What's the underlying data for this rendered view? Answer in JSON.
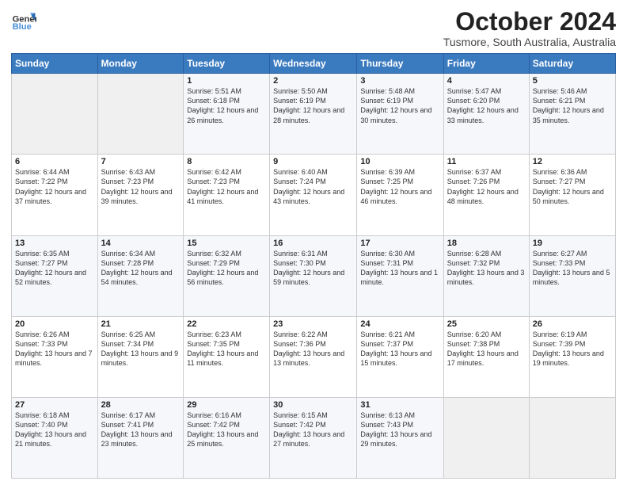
{
  "header": {
    "title": "October 2024",
    "subtitle": "Tusmore, South Australia, Australia"
  },
  "calendar": {
    "days": [
      "Sunday",
      "Monday",
      "Tuesday",
      "Wednesday",
      "Thursday",
      "Friday",
      "Saturday"
    ]
  },
  "weeks": [
    [
      {
        "day": null,
        "info": null
      },
      {
        "day": null,
        "info": null
      },
      {
        "day": "1",
        "info": "Sunrise: 5:51 AM\nSunset: 6:18 PM\nDaylight: 12 hours\nand 26 minutes."
      },
      {
        "day": "2",
        "info": "Sunrise: 5:50 AM\nSunset: 6:19 PM\nDaylight: 12 hours\nand 28 minutes."
      },
      {
        "day": "3",
        "info": "Sunrise: 5:48 AM\nSunset: 6:19 PM\nDaylight: 12 hours\nand 30 minutes."
      },
      {
        "day": "4",
        "info": "Sunrise: 5:47 AM\nSunset: 6:20 PM\nDaylight: 12 hours\nand 33 minutes."
      },
      {
        "day": "5",
        "info": "Sunrise: 5:46 AM\nSunset: 6:21 PM\nDaylight: 12 hours\nand 35 minutes."
      }
    ],
    [
      {
        "day": "6",
        "info": "Sunrise: 6:44 AM\nSunset: 7:22 PM\nDaylight: 12 hours\nand 37 minutes."
      },
      {
        "day": "7",
        "info": "Sunrise: 6:43 AM\nSunset: 7:23 PM\nDaylight: 12 hours\nand 39 minutes."
      },
      {
        "day": "8",
        "info": "Sunrise: 6:42 AM\nSunset: 7:23 PM\nDaylight: 12 hours\nand 41 minutes."
      },
      {
        "day": "9",
        "info": "Sunrise: 6:40 AM\nSunset: 7:24 PM\nDaylight: 12 hours\nand 43 minutes."
      },
      {
        "day": "10",
        "info": "Sunrise: 6:39 AM\nSunset: 7:25 PM\nDaylight: 12 hours\nand 46 minutes."
      },
      {
        "day": "11",
        "info": "Sunrise: 6:37 AM\nSunset: 7:26 PM\nDaylight: 12 hours\nand 48 minutes."
      },
      {
        "day": "12",
        "info": "Sunrise: 6:36 AM\nSunset: 7:27 PM\nDaylight: 12 hours\nand 50 minutes."
      }
    ],
    [
      {
        "day": "13",
        "info": "Sunrise: 6:35 AM\nSunset: 7:27 PM\nDaylight: 12 hours\nand 52 minutes."
      },
      {
        "day": "14",
        "info": "Sunrise: 6:34 AM\nSunset: 7:28 PM\nDaylight: 12 hours\nand 54 minutes."
      },
      {
        "day": "15",
        "info": "Sunrise: 6:32 AM\nSunset: 7:29 PM\nDaylight: 12 hours\nand 56 minutes."
      },
      {
        "day": "16",
        "info": "Sunrise: 6:31 AM\nSunset: 7:30 PM\nDaylight: 12 hours\nand 59 minutes."
      },
      {
        "day": "17",
        "info": "Sunrise: 6:30 AM\nSunset: 7:31 PM\nDaylight: 13 hours\nand 1 minute."
      },
      {
        "day": "18",
        "info": "Sunrise: 6:28 AM\nSunset: 7:32 PM\nDaylight: 13 hours\nand 3 minutes."
      },
      {
        "day": "19",
        "info": "Sunrise: 6:27 AM\nSunset: 7:33 PM\nDaylight: 13 hours\nand 5 minutes."
      }
    ],
    [
      {
        "day": "20",
        "info": "Sunrise: 6:26 AM\nSunset: 7:33 PM\nDaylight: 13 hours\nand 7 minutes."
      },
      {
        "day": "21",
        "info": "Sunrise: 6:25 AM\nSunset: 7:34 PM\nDaylight: 13 hours\nand 9 minutes."
      },
      {
        "day": "22",
        "info": "Sunrise: 6:23 AM\nSunset: 7:35 PM\nDaylight: 13 hours\nand 11 minutes."
      },
      {
        "day": "23",
        "info": "Sunrise: 6:22 AM\nSunset: 7:36 PM\nDaylight: 13 hours\nand 13 minutes."
      },
      {
        "day": "24",
        "info": "Sunrise: 6:21 AM\nSunset: 7:37 PM\nDaylight: 13 hours\nand 15 minutes."
      },
      {
        "day": "25",
        "info": "Sunrise: 6:20 AM\nSunset: 7:38 PM\nDaylight: 13 hours\nand 17 minutes."
      },
      {
        "day": "26",
        "info": "Sunrise: 6:19 AM\nSunset: 7:39 PM\nDaylight: 13 hours\nand 19 minutes."
      }
    ],
    [
      {
        "day": "27",
        "info": "Sunrise: 6:18 AM\nSunset: 7:40 PM\nDaylight: 13 hours\nand 21 minutes."
      },
      {
        "day": "28",
        "info": "Sunrise: 6:17 AM\nSunset: 7:41 PM\nDaylight: 13 hours\nand 23 minutes."
      },
      {
        "day": "29",
        "info": "Sunrise: 6:16 AM\nSunset: 7:42 PM\nDaylight: 13 hours\nand 25 minutes."
      },
      {
        "day": "30",
        "info": "Sunrise: 6:15 AM\nSunset: 7:42 PM\nDaylight: 13 hours\nand 27 minutes."
      },
      {
        "day": "31",
        "info": "Sunrise: 6:13 AM\nSunset: 7:43 PM\nDaylight: 13 hours\nand 29 minutes."
      },
      {
        "day": null,
        "info": null
      },
      {
        "day": null,
        "info": null
      }
    ]
  ]
}
